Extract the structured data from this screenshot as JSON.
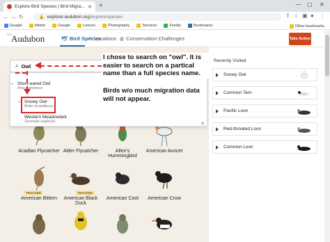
{
  "browser": {
    "tab_title": "Explore Bird Species | Bird Migra...",
    "url_host": "explorer.audubon.org",
    "url_path": "/explore/species",
    "bookmarks": [
      "Google",
      "Admin",
      "Google",
      "Leisure",
      "Photography",
      "Services",
      "Feedly",
      "Bookmarks"
    ],
    "other_bookmarks": "Other bookmarks"
  },
  "site": {
    "logo": "Audubon",
    "nav": [
      "Bird Species",
      "Locations",
      "Conservation Challenges"
    ],
    "take_action": "Take Action"
  },
  "search": {
    "value": "Owl",
    "suggestions": [
      {
        "name": "Short-eared Owl",
        "sci": "Asio flammeus"
      },
      {
        "name": "Snowy Owl",
        "sci": "Bubo scandiacus"
      },
      {
        "name": "Western Meadowlark",
        "sci": "Sturnella neglecta"
      }
    ]
  },
  "annotations": {
    "text1": "I chose to search on \"owl\". It is easier to search on a partical name than a full species name.",
    "text2": "Birds w/o much migration data will not appear."
  },
  "birds": [
    {
      "name": "Acadian Flycatcher",
      "tracked": false
    },
    {
      "name": "Alder Flycatcher",
      "tracked": false
    },
    {
      "name": "Allen's Hummingbird",
      "tracked": false
    },
    {
      "name": "American Avocet",
      "tracked": false
    },
    {
      "name": "American Bittern",
      "tracked": true
    },
    {
      "name": "American Black Duck",
      "tracked": true
    },
    {
      "name": "American Coot",
      "tracked": false
    },
    {
      "name": "American Crow",
      "tracked": false
    }
  ],
  "tracked_label": "TRACKED",
  "recently_visited": {
    "title": "Recently Visited",
    "items": [
      "Snowy Owl",
      "Common Tern",
      "Pacific Loon",
      "Red-throated Loon",
      "Common Loon"
    ]
  }
}
